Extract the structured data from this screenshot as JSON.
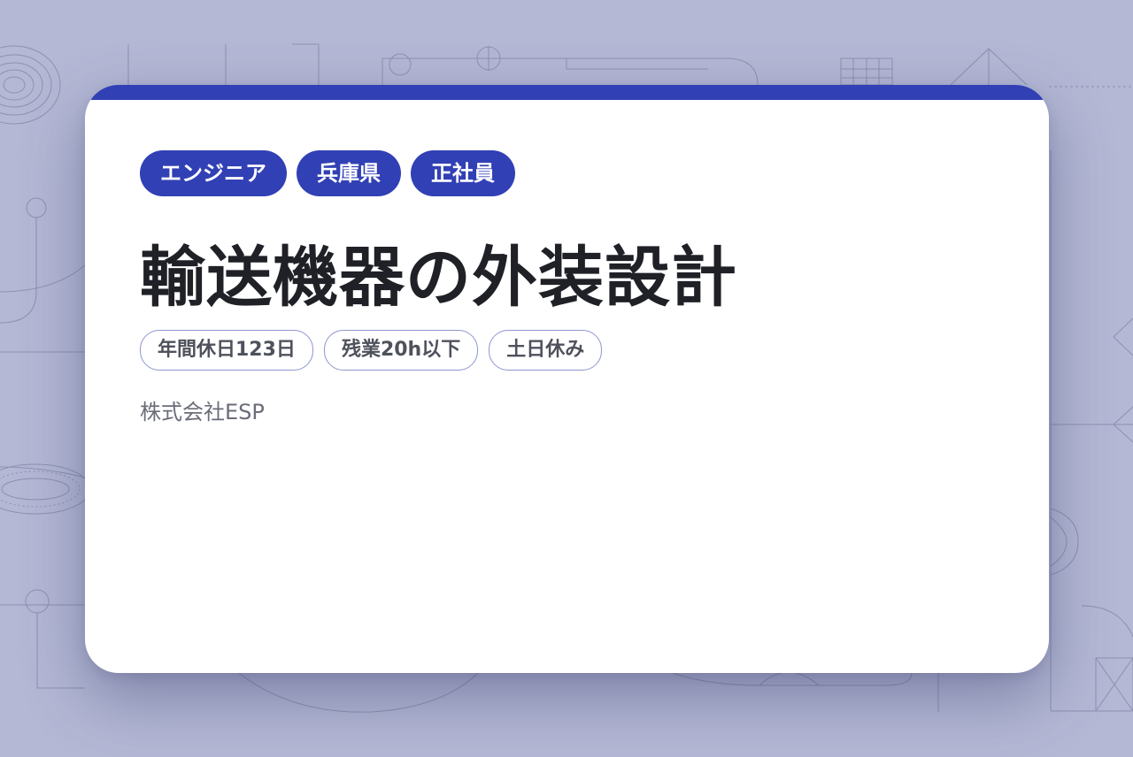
{
  "tags": [
    "エンジニア",
    "兵庫県",
    "正社員"
  ],
  "title": "輸送機器の外装設計",
  "features": [
    "年間休日123日",
    "残業20h以下",
    "土日休み"
  ],
  "company": "株式会社ESP",
  "colors": {
    "background": "#b4b8d5",
    "accent": "#3140b4",
    "card": "#ffffff",
    "title_text": "#1f2127",
    "feature_border": "#8f97cf"
  }
}
